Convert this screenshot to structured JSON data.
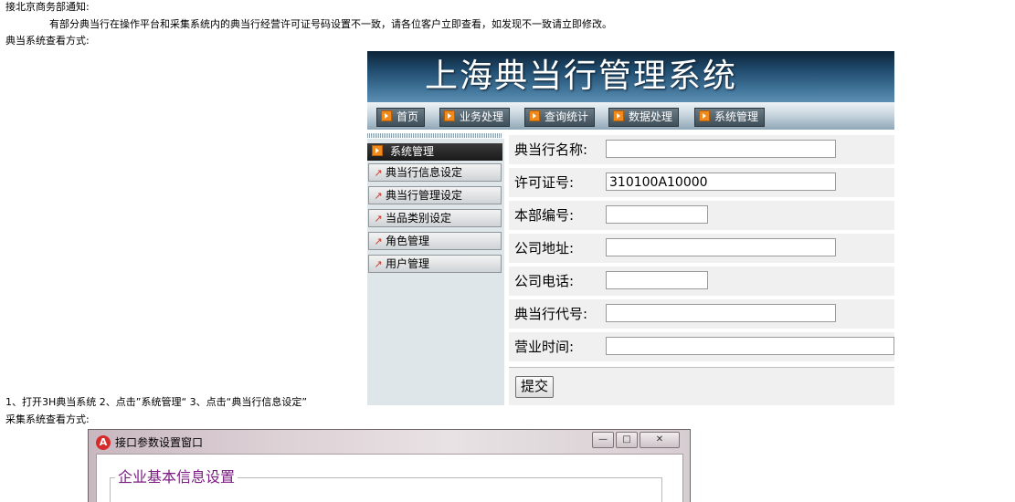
{
  "notice": {
    "header": "接北京商务部通知:",
    "body": "有部分典当行在操作平台和采集系统内的典当行经营许可证号码设置不一致，请各位客户立即查看，如发现不一致请立即修改。",
    "pawn_system_heading": "典当系统查看方式:",
    "steps": "1、打开3H典当系统    2、点击”系统管理“    3、点击“典当行信息设定”",
    "collection_heading": "采集系统查看方式:"
  },
  "pawn_system": {
    "title": "上海典当行管理系统",
    "nav": [
      "首页",
      "业务处理",
      "查询统计",
      "数据处理",
      "系统管理"
    ],
    "sidebar": {
      "header": "系统管理",
      "items": [
        "典当行信息设定",
        "典当行管理设定",
        "当品类别设定",
        "角色管理",
        "用户管理"
      ]
    },
    "form": {
      "fields": [
        {
          "label": "典当行名称:",
          "value": ""
        },
        {
          "label": "许可证号:",
          "value": "310100A10000"
        },
        {
          "label": "本部编号:",
          "value": ""
        },
        {
          "label": "公司地址:",
          "value": ""
        },
        {
          "label": "公司电话:",
          "value": ""
        },
        {
          "label": "典当行代号:",
          "value": ""
        },
        {
          "label": "营业时间:",
          "value": ""
        }
      ],
      "submit_label": "提交"
    }
  },
  "collection_window": {
    "title": "接口参数设置窗口",
    "group_title": "企业基本信息设置"
  }
}
